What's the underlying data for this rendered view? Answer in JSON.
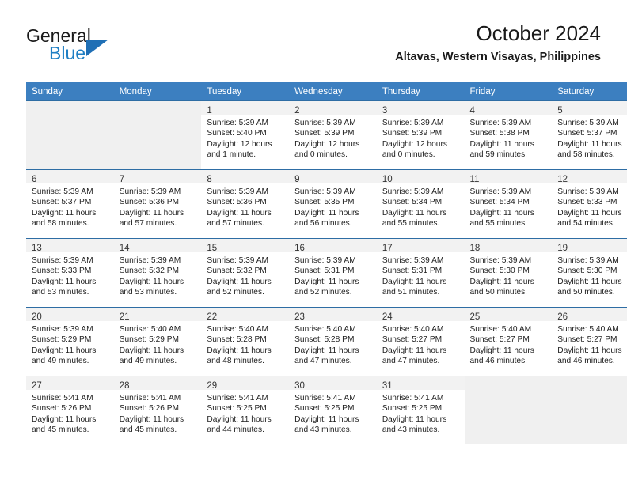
{
  "logo": {
    "word1": "General",
    "word2": "Blue",
    "accent_color": "#1f7fc4"
  },
  "header": {
    "title": "October 2024",
    "subtitle": "Altavas, Western Visayas, Philippines"
  },
  "calendar": {
    "header_bg": "#3c7fc0",
    "weekday_headers": [
      "Sunday",
      "Monday",
      "Tuesday",
      "Wednesday",
      "Thursday",
      "Friday",
      "Saturday"
    ],
    "weeks": [
      [
        {
          "day": ""
        },
        {
          "day": ""
        },
        {
          "day": "1",
          "sunrise": "Sunrise: 5:39 AM",
          "sunset": "Sunset: 5:40 PM",
          "daylight_line1": "Daylight: 12 hours",
          "daylight_line2": "and 1 minute."
        },
        {
          "day": "2",
          "sunrise": "Sunrise: 5:39 AM",
          "sunset": "Sunset: 5:39 PM",
          "daylight_line1": "Daylight: 12 hours",
          "daylight_line2": "and 0 minutes."
        },
        {
          "day": "3",
          "sunrise": "Sunrise: 5:39 AM",
          "sunset": "Sunset: 5:39 PM",
          "daylight_line1": "Daylight: 12 hours",
          "daylight_line2": "and 0 minutes."
        },
        {
          "day": "4",
          "sunrise": "Sunrise: 5:39 AM",
          "sunset": "Sunset: 5:38 PM",
          "daylight_line1": "Daylight: 11 hours",
          "daylight_line2": "and 59 minutes."
        },
        {
          "day": "5",
          "sunrise": "Sunrise: 5:39 AM",
          "sunset": "Sunset: 5:37 PM",
          "daylight_line1": "Daylight: 11 hours",
          "daylight_line2": "and 58 minutes."
        }
      ],
      [
        {
          "day": "6",
          "sunrise": "Sunrise: 5:39 AM",
          "sunset": "Sunset: 5:37 PM",
          "daylight_line1": "Daylight: 11 hours",
          "daylight_line2": "and 58 minutes."
        },
        {
          "day": "7",
          "sunrise": "Sunrise: 5:39 AM",
          "sunset": "Sunset: 5:36 PM",
          "daylight_line1": "Daylight: 11 hours",
          "daylight_line2": "and 57 minutes."
        },
        {
          "day": "8",
          "sunrise": "Sunrise: 5:39 AM",
          "sunset": "Sunset: 5:36 PM",
          "daylight_line1": "Daylight: 11 hours",
          "daylight_line2": "and 57 minutes."
        },
        {
          "day": "9",
          "sunrise": "Sunrise: 5:39 AM",
          "sunset": "Sunset: 5:35 PM",
          "daylight_line1": "Daylight: 11 hours",
          "daylight_line2": "and 56 minutes."
        },
        {
          "day": "10",
          "sunrise": "Sunrise: 5:39 AM",
          "sunset": "Sunset: 5:34 PM",
          "daylight_line1": "Daylight: 11 hours",
          "daylight_line2": "and 55 minutes."
        },
        {
          "day": "11",
          "sunrise": "Sunrise: 5:39 AM",
          "sunset": "Sunset: 5:34 PM",
          "daylight_line1": "Daylight: 11 hours",
          "daylight_line2": "and 55 minutes."
        },
        {
          "day": "12",
          "sunrise": "Sunrise: 5:39 AM",
          "sunset": "Sunset: 5:33 PM",
          "daylight_line1": "Daylight: 11 hours",
          "daylight_line2": "and 54 minutes."
        }
      ],
      [
        {
          "day": "13",
          "sunrise": "Sunrise: 5:39 AM",
          "sunset": "Sunset: 5:33 PM",
          "daylight_line1": "Daylight: 11 hours",
          "daylight_line2": "and 53 minutes."
        },
        {
          "day": "14",
          "sunrise": "Sunrise: 5:39 AM",
          "sunset": "Sunset: 5:32 PM",
          "daylight_line1": "Daylight: 11 hours",
          "daylight_line2": "and 53 minutes."
        },
        {
          "day": "15",
          "sunrise": "Sunrise: 5:39 AM",
          "sunset": "Sunset: 5:32 PM",
          "daylight_line1": "Daylight: 11 hours",
          "daylight_line2": "and 52 minutes."
        },
        {
          "day": "16",
          "sunrise": "Sunrise: 5:39 AM",
          "sunset": "Sunset: 5:31 PM",
          "daylight_line1": "Daylight: 11 hours",
          "daylight_line2": "and 52 minutes."
        },
        {
          "day": "17",
          "sunrise": "Sunrise: 5:39 AM",
          "sunset": "Sunset: 5:31 PM",
          "daylight_line1": "Daylight: 11 hours",
          "daylight_line2": "and 51 minutes."
        },
        {
          "day": "18",
          "sunrise": "Sunrise: 5:39 AM",
          "sunset": "Sunset: 5:30 PM",
          "daylight_line1": "Daylight: 11 hours",
          "daylight_line2": "and 50 minutes."
        },
        {
          "day": "19",
          "sunrise": "Sunrise: 5:39 AM",
          "sunset": "Sunset: 5:30 PM",
          "daylight_line1": "Daylight: 11 hours",
          "daylight_line2": "and 50 minutes."
        }
      ],
      [
        {
          "day": "20",
          "sunrise": "Sunrise: 5:39 AM",
          "sunset": "Sunset: 5:29 PM",
          "daylight_line1": "Daylight: 11 hours",
          "daylight_line2": "and 49 minutes."
        },
        {
          "day": "21",
          "sunrise": "Sunrise: 5:40 AM",
          "sunset": "Sunset: 5:29 PM",
          "daylight_line1": "Daylight: 11 hours",
          "daylight_line2": "and 49 minutes."
        },
        {
          "day": "22",
          "sunrise": "Sunrise: 5:40 AM",
          "sunset": "Sunset: 5:28 PM",
          "daylight_line1": "Daylight: 11 hours",
          "daylight_line2": "and 48 minutes."
        },
        {
          "day": "23",
          "sunrise": "Sunrise: 5:40 AM",
          "sunset": "Sunset: 5:28 PM",
          "daylight_line1": "Daylight: 11 hours",
          "daylight_line2": "and 47 minutes."
        },
        {
          "day": "24",
          "sunrise": "Sunrise: 5:40 AM",
          "sunset": "Sunset: 5:27 PM",
          "daylight_line1": "Daylight: 11 hours",
          "daylight_line2": "and 47 minutes."
        },
        {
          "day": "25",
          "sunrise": "Sunrise: 5:40 AM",
          "sunset": "Sunset: 5:27 PM",
          "daylight_line1": "Daylight: 11 hours",
          "daylight_line2": "and 46 minutes."
        },
        {
          "day": "26",
          "sunrise": "Sunrise: 5:40 AM",
          "sunset": "Sunset: 5:27 PM",
          "daylight_line1": "Daylight: 11 hours",
          "daylight_line2": "and 46 minutes."
        }
      ],
      [
        {
          "day": "27",
          "sunrise": "Sunrise: 5:41 AM",
          "sunset": "Sunset: 5:26 PM",
          "daylight_line1": "Daylight: 11 hours",
          "daylight_line2": "and 45 minutes."
        },
        {
          "day": "28",
          "sunrise": "Sunrise: 5:41 AM",
          "sunset": "Sunset: 5:26 PM",
          "daylight_line1": "Daylight: 11 hours",
          "daylight_line2": "and 45 minutes."
        },
        {
          "day": "29",
          "sunrise": "Sunrise: 5:41 AM",
          "sunset": "Sunset: 5:25 PM",
          "daylight_line1": "Daylight: 11 hours",
          "daylight_line2": "and 44 minutes."
        },
        {
          "day": "30",
          "sunrise": "Sunrise: 5:41 AM",
          "sunset": "Sunset: 5:25 PM",
          "daylight_line1": "Daylight: 11 hours",
          "daylight_line2": "and 43 minutes."
        },
        {
          "day": "31",
          "sunrise": "Sunrise: 5:41 AM",
          "sunset": "Sunset: 5:25 PM",
          "daylight_line1": "Daylight: 11 hours",
          "daylight_line2": "and 43 minutes."
        },
        {
          "day": ""
        },
        {
          "day": ""
        }
      ]
    ]
  }
}
